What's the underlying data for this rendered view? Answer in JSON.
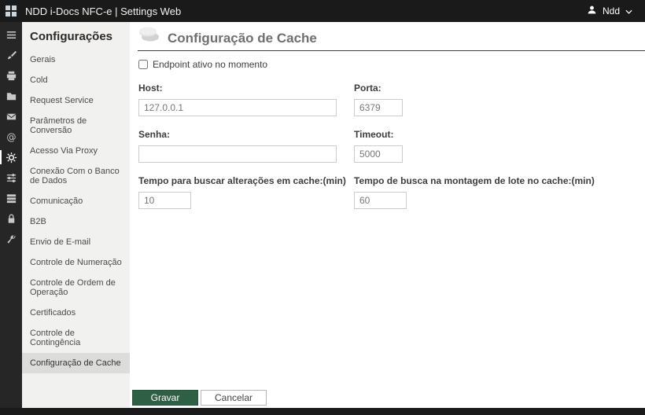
{
  "topbar": {
    "title": "NDD i-Docs NFC-e | Settings Web",
    "user": "Ndd"
  },
  "icon_rail": {
    "items": [
      {
        "name": "menu",
        "selected": false
      },
      {
        "name": "brush",
        "selected": false
      },
      {
        "name": "printer",
        "selected": false
      },
      {
        "name": "folder",
        "selected": false
      },
      {
        "name": "envelope",
        "selected": false
      },
      {
        "name": "at-sign",
        "selected": false
      },
      {
        "name": "gear",
        "selected": true
      },
      {
        "name": "sliders",
        "selected": false
      },
      {
        "name": "rows",
        "selected": false
      },
      {
        "name": "lock",
        "selected": false
      },
      {
        "name": "wrench",
        "selected": false
      }
    ]
  },
  "sidebar": {
    "title": "Configurações",
    "items": [
      {
        "label": "Gerais",
        "selected": false
      },
      {
        "label": "Cold",
        "selected": false
      },
      {
        "label": "Request Service",
        "selected": false
      },
      {
        "label": "Parâmetros de Conversão",
        "selected": false
      },
      {
        "label": "Acesso Via Proxy",
        "selected": false
      },
      {
        "label": "Conexão Com o Banco de Dados",
        "selected": false
      },
      {
        "label": "Comunicação",
        "selected": false
      },
      {
        "label": "B2B",
        "selected": false
      },
      {
        "label": "Envio de E-mail",
        "selected": false
      },
      {
        "label": "Controle de Numeração",
        "selected": false
      },
      {
        "label": "Controle de Ordem de Operação",
        "selected": false
      },
      {
        "label": "Certificados",
        "selected": false
      },
      {
        "label": "Controle de Contingência",
        "selected": false
      },
      {
        "label": "Configuração de Cache",
        "selected": true
      }
    ]
  },
  "main": {
    "title": "Configuração de Cache",
    "checkbox_label": "Endpoint ativo no momento",
    "checkbox_checked": false,
    "fields": {
      "host": {
        "label": "Host:",
        "value": "127.0.0.1"
      },
      "porta": {
        "label": "Porta:",
        "value": "6379"
      },
      "senha": {
        "label": "Senha:",
        "value": ""
      },
      "timeout": {
        "label": "Timeout:",
        "value": "5000"
      },
      "tempo_buscar": {
        "label": "Tempo para buscar alterações em cache:(min)",
        "value": "10"
      },
      "tempo_lote": {
        "label": "Tempo de busca na montagem de lote no cache:(min)",
        "value": "60"
      }
    },
    "buttons": {
      "save": "Gravar",
      "cancel": "Cancelar"
    }
  },
  "colors": {
    "topbar_bg": "#1a1a1a",
    "rail_bg": "#262626",
    "sidebar_bg": "#f1f1f0",
    "sidebar_selected_bg": "#dcdcdb",
    "accent_green": "#2f5f45"
  }
}
